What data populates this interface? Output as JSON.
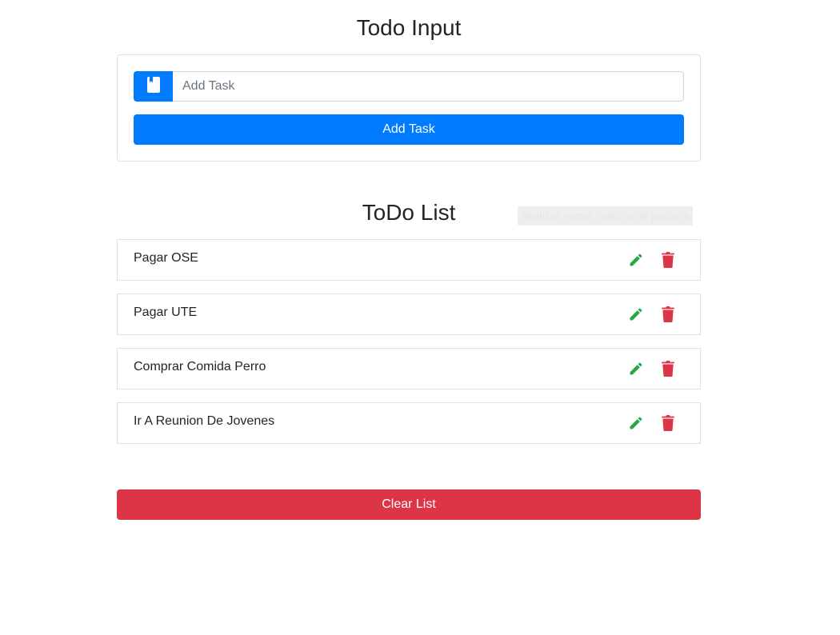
{
  "input_section": {
    "title": "Todo Input",
    "placeholder": "Add Task",
    "value": "",
    "prepend_icon": "book-icon",
    "add_button_label": "Add Task"
  },
  "list_section": {
    "title": "ToDo List",
    "items": [
      {
        "text": "Pagar OSE"
      },
      {
        "text": "Pagar UTE"
      },
      {
        "text": "Comprar Comida Perro"
      },
      {
        "text": "Ir A Reunion De Jovenes"
      }
    ],
    "edit_icon": "pencil-icon",
    "delete_icon": "trash-icon"
  },
  "clear_button_label": "Clear List",
  "tooltip_text": "Realizar nueva captura de pantalla",
  "colors": {
    "primary": "#007bff",
    "danger": "#dc3545",
    "success": "#28a745"
  }
}
